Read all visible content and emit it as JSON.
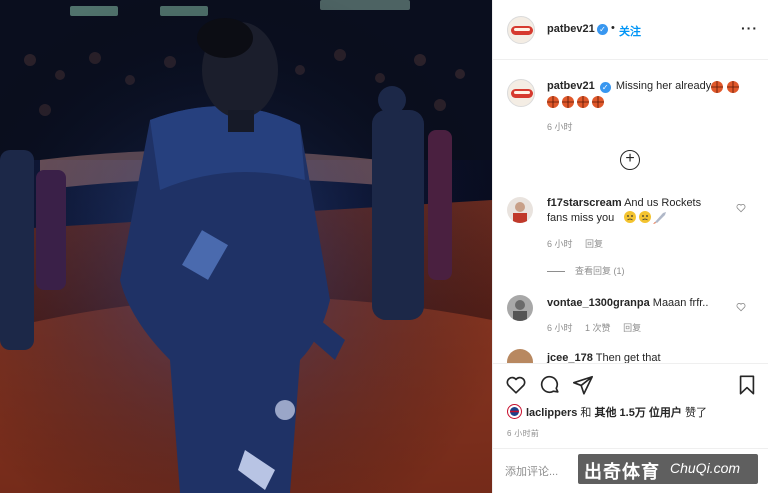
{
  "post": {
    "author": "patbev21",
    "follow_label": "关注",
    "caption_text": "Missing her already",
    "caption_emojis": [
      "basketball",
      "basketball",
      "basketball",
      "basketball",
      "basketball",
      "basketball"
    ],
    "caption_time": "6 小时"
  },
  "comments": [
    {
      "user": "f17starscream",
      "text_line1": "And us Rockets",
      "text_line2": "fans miss you",
      "time": "6 小时",
      "reply_label": "回复",
      "view_replies": "查看回复 (1)"
    },
    {
      "user": "vontae_1300granpa",
      "text": "Maaan frfr..",
      "time": "6 小时",
      "likes_label": "1 次赞",
      "reply_label": "回复"
    },
    {
      "user": "jcee_178",
      "text": "Then get that"
    }
  ],
  "actions": {
    "liked_by_user": "laclippers",
    "likes_text_prefix": "和",
    "likes_text_others": "其他 1.5万 位用户",
    "likes_text_suffix": "赞了",
    "time_ago": "6 小时前",
    "add_comment_placeholder": "添加评论..."
  },
  "watermark": {
    "cn": "出奇体育",
    "en": "ChuQi.com"
  },
  "colors": {
    "link_blue": "#0095f6",
    "verified_blue": "#3897f0",
    "muted_text": "#8e8e8e",
    "basketball": "#e0582a"
  }
}
